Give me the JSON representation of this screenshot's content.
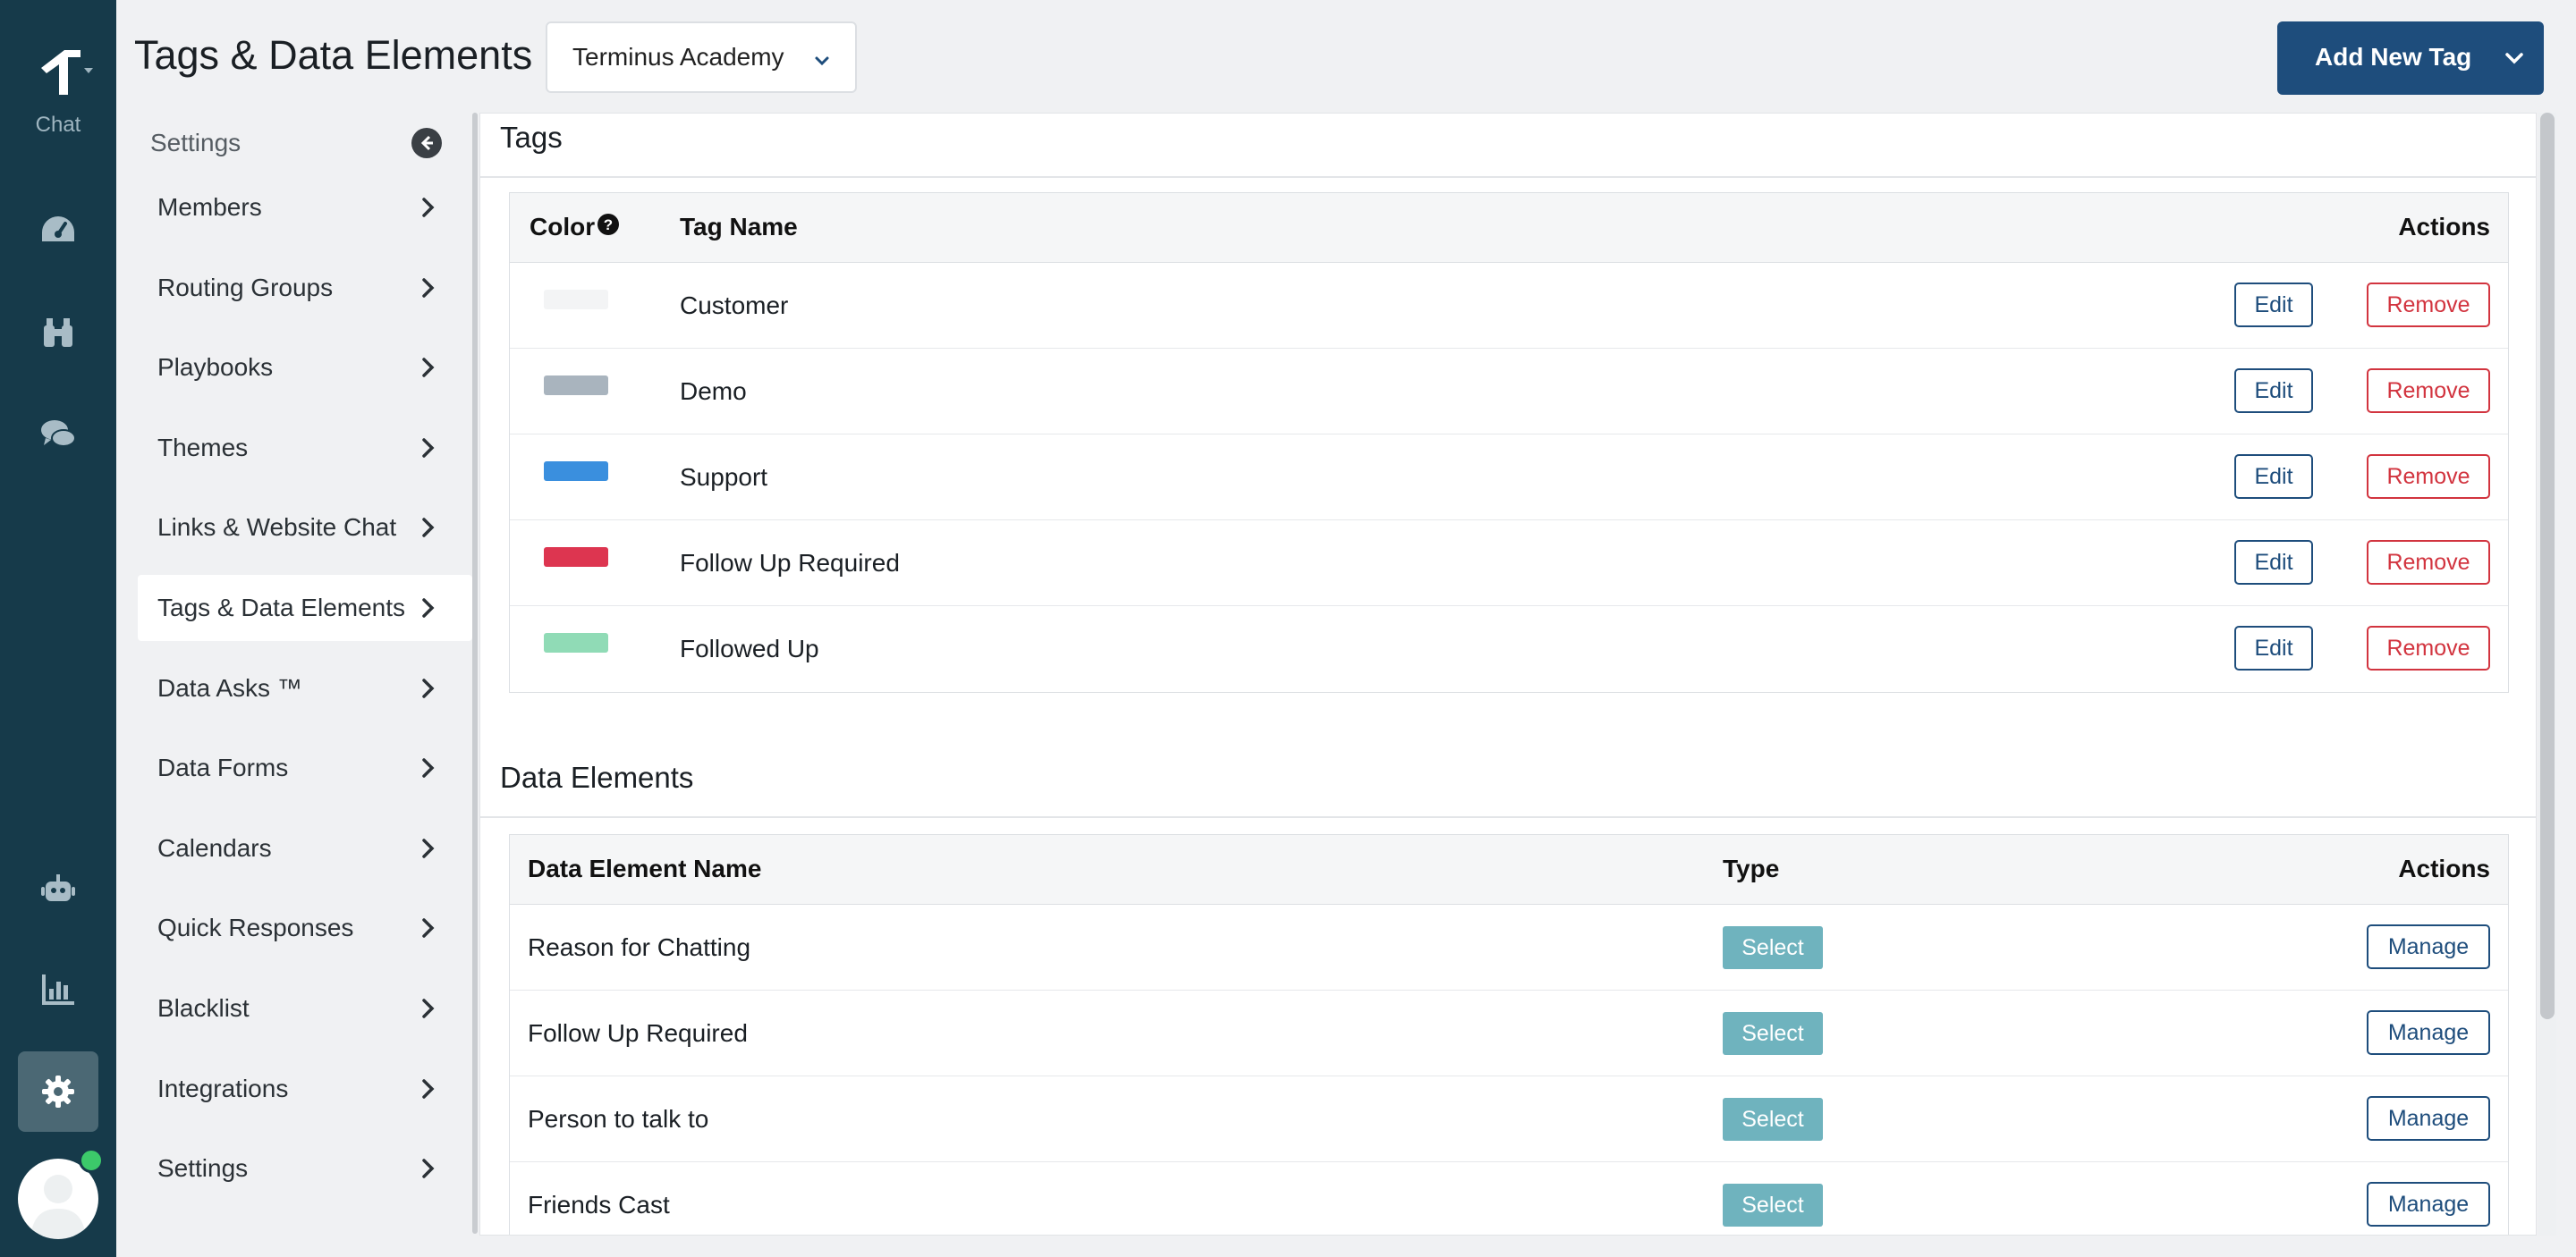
{
  "rail": {
    "logo_label": "Chat",
    "icons": [
      "dashboard-icon",
      "binoculars-icon",
      "chat-bubbles-icon",
      "bot-icon",
      "analytics-icon",
      "settings-gear-icon"
    ]
  },
  "header": {
    "title": "Tags & Data Elements",
    "org_select_value": "Terminus Academy",
    "add_button_label": "Add New Tag"
  },
  "sidebar": {
    "heading": "Settings",
    "items": [
      {
        "label": "Members"
      },
      {
        "label": "Routing Groups"
      },
      {
        "label": "Playbooks"
      },
      {
        "label": "Themes"
      },
      {
        "label": "Links & Website Chat"
      },
      {
        "label": "Tags & Data Elements",
        "active": true
      },
      {
        "label": "Data Asks ™"
      },
      {
        "label": "Data Forms"
      },
      {
        "label": "Calendars"
      },
      {
        "label": "Quick Responses"
      },
      {
        "label": "Blacklist"
      },
      {
        "label": "Integrations"
      },
      {
        "label": "Settings"
      }
    ]
  },
  "tags": {
    "section_title": "Tags",
    "col_color": "Color",
    "col_name": "Tag Name",
    "col_actions": "Actions",
    "edit_label": "Edit",
    "remove_label": "Remove",
    "rows": [
      {
        "name": "Customer",
        "color": "#f3f4f5"
      },
      {
        "name": "Demo",
        "color": "#a9b4be"
      },
      {
        "name": "Support",
        "color": "#3a8fde"
      },
      {
        "name": "Follow Up Required",
        "color": "#dd3550"
      },
      {
        "name": "Followed Up",
        "color": "#90dbb6"
      }
    ]
  },
  "data_elements": {
    "section_title": "Data Elements",
    "col_name": "Data Element Name",
    "col_type": "Type",
    "col_actions": "Actions",
    "manage_label": "Manage",
    "rows": [
      {
        "name": "Reason for Chatting",
        "type": "Select"
      },
      {
        "name": "Follow Up Required",
        "type": "Select"
      },
      {
        "name": "Person to talk to",
        "type": "Select"
      },
      {
        "name": "Friends Cast",
        "type": "Select"
      }
    ]
  },
  "colors": {
    "rail_bg": "#163a4a",
    "primary": "#1e4d7c",
    "danger": "#d2343f",
    "badge": "#6fb3be"
  }
}
